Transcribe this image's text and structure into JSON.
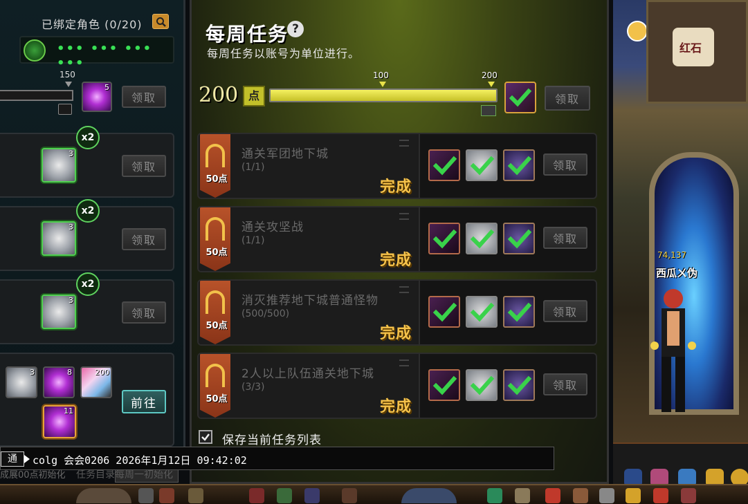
{
  "left_panel": {
    "bound_label": "已绑定角色 (0/20)",
    "energy_dots": "••• ••• ••• •••",
    "bar_mark": "150",
    "bar_item_count": "5",
    "claim_label": "领取",
    "rows": [
      {
        "multiplier": "x2",
        "item_count": "3",
        "claim_label": "领取"
      },
      {
        "multiplier": "x2",
        "item_count": "3",
        "claim_label": "领取"
      },
      {
        "multiplier": "x2",
        "item_count": "3",
        "claim_label": "领取"
      }
    ],
    "bottom_row": {
      "items": [
        "3",
        "8",
        "200",
        "11"
      ],
      "go_label": "前往"
    },
    "footer_text": "成展00点初始化"
  },
  "weekly": {
    "title": "每周任务",
    "subtitle": "每周任务以账号为单位进行。",
    "points": "200",
    "points_unit": "点",
    "progress_fraction": 1.0,
    "mark_100": "100",
    "mark_200": "200",
    "claim_label": "领取",
    "tasks": [
      {
        "pts": "50点",
        "name": "通关军团地下城",
        "progress": "(1/1)",
        "status": "完成",
        "claim_label": "领取"
      },
      {
        "pts": "50点",
        "name": "通关攻坚战",
        "progress": "(1/1)",
        "status": "完成",
        "claim_label": "领取"
      },
      {
        "pts": "50点",
        "name": "消灭推荐地下城普通怪物",
        "progress": "(500/500)",
        "status": "完成",
        "claim_label": "领取"
      },
      {
        "pts": "50点",
        "name": "2人以上队伍通关地下城",
        "progress": "(3/3)",
        "status": "完成",
        "claim_label": "领取"
      }
    ],
    "save_label": "保存当前任务列表",
    "footer_text": "任务目录每周一初始化"
  },
  "chat": {
    "channel": "通",
    "message": "colg 会会0206 2026年1月12日 09:42:02"
  },
  "scene": {
    "map_label": "红石",
    "char_level": "74,137",
    "char_name": "西瓜ㄨ伪"
  },
  "colors": {
    "accent_gold": "#f5c24a",
    "check_green": "#39d24a",
    "progress_yellow": "#e8e24a"
  },
  "icons": [
    "search-icon",
    "help-icon",
    "energy-icon",
    "check-icon",
    "lock-icon",
    "chest-icon"
  ]
}
